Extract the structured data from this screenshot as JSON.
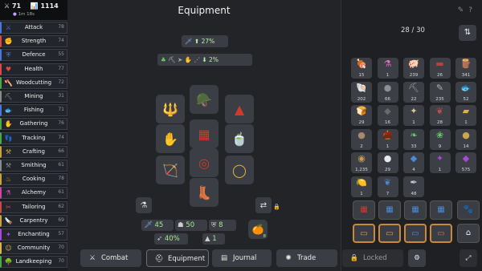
{
  "header": {
    "combat_level": "71",
    "total_level": "1114",
    "subtitle": "1m 18s",
    "title": "Equipment"
  },
  "skills": [
    {
      "name": "Attack",
      "level": "78",
      "icon": "sword-icon",
      "color": "#4a78d8",
      "glyph": "⚔"
    },
    {
      "name": "Strength",
      "level": "74",
      "icon": "fist-icon",
      "color": "#d84a4a",
      "glyph": "✊"
    },
    {
      "name": "Defence",
      "level": "55",
      "icon": "shield-icon",
      "color": "#4a78d8",
      "glyph": "⛨"
    },
    {
      "name": "Health",
      "level": "77",
      "icon": "heart-icon",
      "color": "#d84a4a",
      "glyph": "♥"
    },
    {
      "name": "Woodcutting",
      "level": "72",
      "icon": "axe-icon",
      "color": "#4aa84a",
      "glyph": "🪓"
    },
    {
      "name": "Mining",
      "level": "31",
      "icon": "pickaxe-icon",
      "color": "#8a8a8a",
      "glyph": "⛏"
    },
    {
      "name": "Fishing",
      "level": "71",
      "icon": "fish-icon",
      "color": "#4a78d8",
      "glyph": "🐟"
    },
    {
      "name": "Gathering",
      "level": "76",
      "icon": "hand-icon",
      "color": "#4aa84a",
      "glyph": "✋"
    },
    {
      "name": "Tracking",
      "level": "74",
      "icon": "footprint-icon",
      "color": "#4aa84a",
      "glyph": "👣"
    },
    {
      "name": "Crafting",
      "level": "66",
      "icon": "hammer-icon",
      "color": "#c8a23a",
      "glyph": "⚒"
    },
    {
      "name": "Smithing",
      "level": "61",
      "icon": "anvil-icon",
      "color": "#8a8a8a",
      "glyph": "⚒"
    },
    {
      "name": "Cooking",
      "level": "78",
      "icon": "pot-icon",
      "color": "#c8a23a",
      "glyph": "♨"
    },
    {
      "name": "Alchemy",
      "level": "61",
      "icon": "flask-icon",
      "color": "#c84aa8",
      "glyph": "⚗"
    },
    {
      "name": "Tailoring",
      "level": "62",
      "icon": "needle-icon",
      "color": "#c84a4a",
      "glyph": "✂"
    },
    {
      "name": "Carpentry",
      "level": "69",
      "icon": "saw-icon",
      "color": "#c8a23a",
      "glyph": "🪚"
    },
    {
      "name": "Enchanting",
      "level": "57",
      "icon": "sparkle-icon",
      "color": "#a84ad8",
      "glyph": "✦"
    },
    {
      "name": "Community",
      "level": "70",
      "icon": "people-icon",
      "color": "#d8b84a",
      "glyph": "☺"
    },
    {
      "name": "Landkeeping",
      "level": "70",
      "icon": "tree-icon",
      "color": "#4aa84a",
      "glyph": "🌳"
    }
  ],
  "boosts": {
    "top_value": "27%",
    "bottom_value": "2%"
  },
  "stats": {
    "attack": "45",
    "defence": "50",
    "armour": "8",
    "crit": "40%",
    "speed": "1",
    "food_count": "8"
  },
  "inventory": {
    "count": "28 / 30",
    "items": [
      {
        "qty": "15",
        "icon": "meat-icon",
        "glyph": "🍖",
        "color": "#c0605a"
      },
      {
        "qty": "1",
        "icon": "potion-icon",
        "glyph": "⚗",
        "color": "#e070c0"
      },
      {
        "qty": "239",
        "icon": "pig-icon",
        "glyph": "🐖",
        "color": "#e79aa6"
      },
      {
        "qty": "26",
        "icon": "plank-icon",
        "glyph": "▬",
        "color": "#b84040"
      },
      {
        "qty": "341",
        "icon": "log-icon",
        "glyph": "🪵",
        "color": "#b88a4a"
      },
      {
        "qty": "202",
        "icon": "shell-icon",
        "glyph": "🐚",
        "color": "#c89a70"
      },
      {
        "qty": "66",
        "icon": "bomb-icon",
        "glyph": "●",
        "color": "#8a8f98"
      },
      {
        "qty": "22",
        "icon": "tool-icon",
        "glyph": "⛏",
        "color": "#9aa0a8"
      },
      {
        "qty": "235",
        "icon": "needle-icon",
        "glyph": "✎",
        "color": "#b0b0b0"
      },
      {
        "qty": "52",
        "icon": "fish-icon",
        "glyph": "🐟",
        "color": "#4a88c8"
      },
      {
        "qty": "29",
        "icon": "bread-icon",
        "glyph": "🍞",
        "color": "#d8a858"
      },
      {
        "qty": "16",
        "icon": "ore-icon",
        "glyph": "◆",
        "color": "#6a6a6a"
      },
      {
        "qty": "1",
        "icon": "spice-icon",
        "glyph": "✦",
        "color": "#d8c88a"
      },
      {
        "qty": "28",
        "icon": "herb-icon",
        "glyph": "❦",
        "color": "#c84a4a"
      },
      {
        "qty": "1",
        "icon": "bar-icon",
        "glyph": "▰",
        "color": "#e0b040"
      },
      {
        "qty": "2",
        "icon": "stone-icon",
        "glyph": "●",
        "color": "#a88a6a"
      },
      {
        "qty": "1",
        "icon": "acorn-icon",
        "glyph": "🌰",
        "color": "#a07040"
      },
      {
        "qty": "33",
        "icon": "leaf-icon",
        "glyph": "❧",
        "color": "#6ac86a"
      },
      {
        "qty": "9",
        "icon": "sprout-icon",
        "glyph": "❀",
        "color": "#6ac86a"
      },
      {
        "qty": "14",
        "icon": "seed-icon",
        "glyph": "●",
        "color": "#c8a84a"
      },
      {
        "qty": "1,235",
        "icon": "coin-pouch-icon",
        "glyph": "◉",
        "color": "#c89a50"
      },
      {
        "qty": "29",
        "icon": "egg-icon",
        "glyph": "●",
        "color": "#e8e8e8"
      },
      {
        "qty": "4",
        "icon": "gem-icon",
        "glyph": "◆",
        "color": "#4a8ad8"
      },
      {
        "qty": "1",
        "icon": "rune-icon",
        "glyph": "✦",
        "color": "#a84ad8"
      },
      {
        "qty": "575",
        "icon": "crystal-icon",
        "glyph": "◆",
        "color": "#a84ad8"
      },
      {
        "qty": "1",
        "icon": "lemon-icon",
        "glyph": "🍋",
        "color": "#e8c840"
      },
      {
        "qty": "7",
        "icon": "herb-bundle-icon",
        "glyph": "❦",
        "color": "#4a88c8"
      },
      {
        "qty": "48",
        "icon": "feather-icon",
        "glyph": "✒",
        "color": "#c8c8d8"
      }
    ]
  },
  "nav": {
    "combat": "Combat",
    "equipment": "Equipment",
    "journal": "Journal",
    "trade": "Trade",
    "locked": "Locked"
  }
}
